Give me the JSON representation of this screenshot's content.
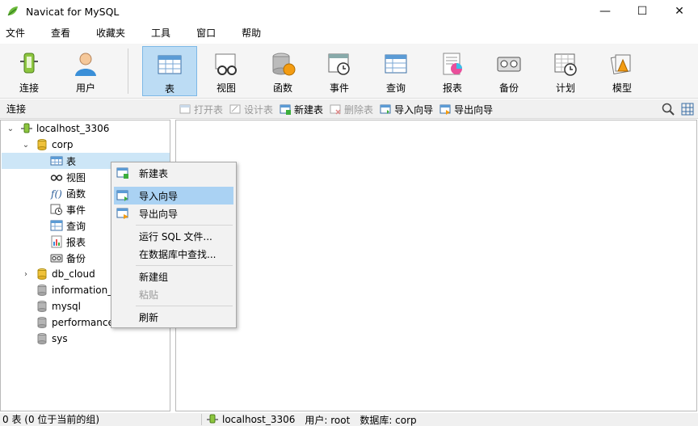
{
  "window": {
    "title": "Navicat for MySQL",
    "minimize": "—",
    "maximize": "☐",
    "close": "✕"
  },
  "menu": [
    "文件",
    "查看",
    "收藏夹",
    "工具",
    "窗口",
    "帮助"
  ],
  "toolbar": [
    {
      "label": "连接",
      "icon": "connection-icon"
    },
    {
      "label": "用户",
      "icon": "user-icon"
    },
    {
      "label": "表",
      "icon": "table-icon",
      "active": true
    },
    {
      "label": "视图",
      "icon": "view-icon"
    },
    {
      "label": "函数",
      "icon": "function-icon"
    },
    {
      "label": "事件",
      "icon": "event-icon"
    },
    {
      "label": "查询",
      "icon": "query-icon"
    },
    {
      "label": "报表",
      "icon": "report-icon"
    },
    {
      "label": "备份",
      "icon": "backup-icon"
    },
    {
      "label": "计划",
      "icon": "schedule-icon"
    },
    {
      "label": "模型",
      "icon": "model-icon"
    }
  ],
  "subbar": {
    "connection_label": "连接",
    "object_buttons": [
      {
        "label": "打开表",
        "disabled": true
      },
      {
        "label": "设计表",
        "disabled": true
      },
      {
        "label": "新建表",
        "disabled": false
      },
      {
        "label": "删除表",
        "disabled": true
      },
      {
        "label": "导入向导",
        "disabled": false
      },
      {
        "label": "导出向导",
        "disabled": false
      }
    ]
  },
  "tree": {
    "connection": "localhost_3306",
    "databases": [
      {
        "name": "corp",
        "open": true
      },
      {
        "name": "db_cloud",
        "open": false
      },
      {
        "name": "information_",
        "open": false
      },
      {
        "name": "mysql",
        "open": false
      },
      {
        "name": "performance_",
        "open": false
      },
      {
        "name": "sys",
        "open": false
      }
    ],
    "corp_children": [
      {
        "label": "表",
        "icon": "table-icon"
      },
      {
        "label": "视图",
        "icon": "view-icon"
      },
      {
        "label": "函数",
        "icon": "function-icon"
      },
      {
        "label": "事件",
        "icon": "event-icon"
      },
      {
        "label": "查询",
        "icon": "query-icon"
      },
      {
        "label": "报表",
        "icon": "report-icon"
      },
      {
        "label": "备份",
        "icon": "backup-icon"
      }
    ]
  },
  "context_menu": {
    "items": [
      {
        "label": "新建表",
        "icon": "new-table-icon"
      },
      {
        "label": "导入向导",
        "icon": "import-wizard-icon",
        "hover": true
      },
      {
        "label": "导出向导",
        "icon": "export-wizard-icon"
      },
      {
        "label": "运行 SQL 文件..."
      },
      {
        "label": "在数据库中查找..."
      },
      {
        "label": "新建组"
      },
      {
        "label": "粘贴",
        "disabled": true
      },
      {
        "label": "刷新"
      }
    ]
  },
  "status": {
    "left": "0 表 (0 位于当前的组)",
    "connection": "localhost_3306",
    "user": "用户: root",
    "database": "数据库: corp"
  },
  "colors": {
    "accent": "#bcdcf4",
    "hover": "#aad2f3",
    "db_yellow": "#f0c23a",
    "db_gray": "#b5b5b5"
  }
}
